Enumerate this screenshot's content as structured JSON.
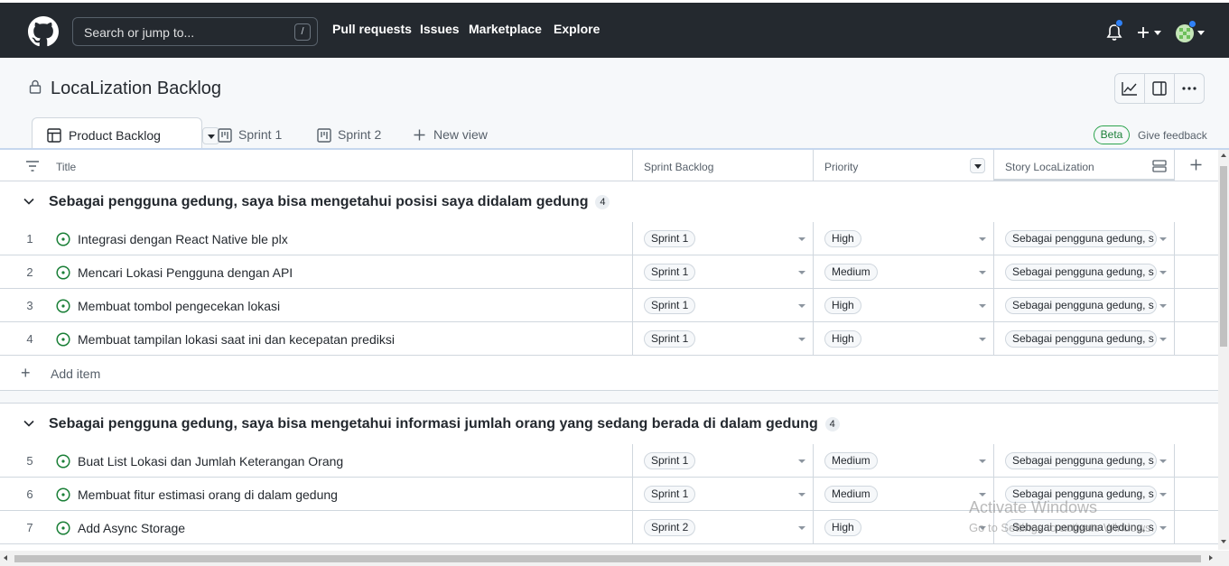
{
  "topbar": {
    "search_placeholder": "Search or jump to...",
    "search_shortcut": "/",
    "nav": [
      "Pull requests",
      "Issues",
      "Marketplace",
      "Explore"
    ],
    "icons": [
      "github-logo",
      "bell-icon",
      "plus-icon",
      "avatar"
    ]
  },
  "project": {
    "title": "LocaLization Backlog"
  },
  "views": {
    "active": "Product Backlog",
    "tabs": [
      "Sprint 1",
      "Sprint 2"
    ],
    "new_view": "New view",
    "beta": "Beta",
    "feedback": "Give feedback"
  },
  "columns": {
    "title": "Title",
    "sprint": "Sprint Backlog",
    "priority": "Priority",
    "story": "Story LocaLization"
  },
  "groups": [
    {
      "title": "Sebagai pengguna gedung, saya bisa mengetahui posisi saya didalam gedung",
      "count": "4",
      "rows": [
        {
          "num": "1",
          "title": "Integrasi dengan React Native ble plx",
          "sprint": "Sprint 1",
          "priority": "High",
          "story": "Sebagai pengguna gedung, s"
        },
        {
          "num": "2",
          "title": "Mencari Lokasi Pengguna dengan API",
          "sprint": "Sprint 1",
          "priority": "Medium",
          "story": "Sebagai pengguna gedung, s"
        },
        {
          "num": "3",
          "title": "Membuat tombol pengecekan lokasi",
          "sprint": "Sprint 1",
          "priority": "High",
          "story": "Sebagai pengguna gedung, s"
        },
        {
          "num": "4",
          "title": "Membuat tampilan lokasi saat ini dan kecepatan prediksi",
          "sprint": "Sprint 1",
          "priority": "High",
          "story": "Sebagai pengguna gedung, s"
        }
      ],
      "add_item": "Add item"
    },
    {
      "title": "Sebagai pengguna gedung, saya bisa mengetahui informasi jumlah orang yang sedang berada di dalam gedung",
      "count": "4",
      "rows": [
        {
          "num": "5",
          "title": "Buat List Lokasi dan Jumlah Keterangan Orang",
          "sprint": "Sprint 1",
          "priority": "Medium",
          "story": "Sebagai pengguna gedung, s"
        },
        {
          "num": "6",
          "title": "Membuat fitur estimasi orang di dalam gedung",
          "sprint": "Sprint 1",
          "priority": "Medium",
          "story": "Sebagai pengguna gedung, s"
        },
        {
          "num": "7",
          "title": "Add Async Storage",
          "sprint": "Sprint 2",
          "priority": "High",
          "story": "Sebagai pengguna gedung, s"
        }
      ]
    }
  ],
  "watermark": {
    "line1": "Activate Windows",
    "line2": "Go to Settings to activate Windows."
  },
  "colors": {
    "topbar": "#24292f",
    "open_issue": "#1a7f37",
    "accent": "#2f81f7"
  }
}
